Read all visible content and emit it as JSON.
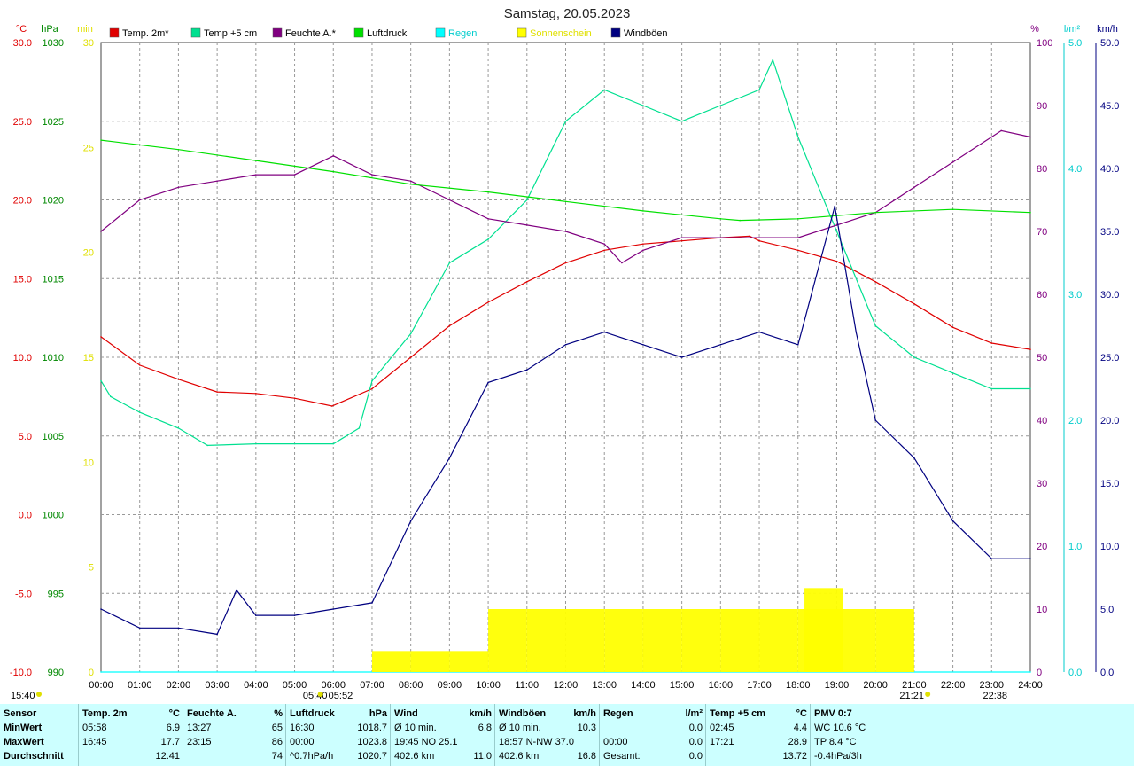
{
  "title": "Samstag, 20.05.2023",
  "axes": {
    "temp": {
      "unit": "°C",
      "ticks": [
        "30.0",
        "25.0",
        "20.0",
        "15.0",
        "10.0",
        "5.0",
        "0.0",
        "-5.0",
        "-10.0"
      ],
      "color": "#ff0000"
    },
    "pressure": {
      "unit": "hPa",
      "ticks": [
        "1030",
        "1025",
        "1020",
        "1015",
        "1010",
        "1005",
        "1000",
        "995",
        "990"
      ],
      "color": "#00aa00"
    },
    "sunshine": {
      "unit": "min",
      "ticks": [
        "30",
        "25",
        "20",
        "15",
        "10",
        "5",
        "0"
      ],
      "color": "#ffff00"
    },
    "humidity": {
      "unit": "%",
      "ticks": [
        "100",
        "90",
        "80",
        "70",
        "60",
        "50",
        "40",
        "30",
        "20",
        "10",
        "0"
      ],
      "color": "#800080"
    },
    "rain": {
      "unit": "l/m²",
      "ticks": [
        "5.0",
        "4.0",
        "3.0",
        "2.0",
        "1.0",
        "0.0"
      ],
      "color": "#00cccc"
    },
    "wind": {
      "unit": "km/h",
      "ticks": [
        "50.0",
        "45.0",
        "40.0",
        "35.0",
        "30.0",
        "25.0",
        "20.0",
        "15.0",
        "10.0",
        "5.0",
        "0.0"
      ],
      "color": "#000080"
    }
  },
  "x_ticks": [
    "00:00",
    "01:00",
    "02:00",
    "03:00",
    "04:00",
    "05:00",
    "06:00",
    "07:00",
    "08:00",
    "09:00",
    "10:00",
    "11:00",
    "12:00",
    "13:00",
    "14:00",
    "15:00",
    "16:00",
    "17:00",
    "18:00",
    "19:00",
    "20:00",
    "21:00",
    "22:00",
    "23:00",
    "24:00"
  ],
  "sun_markers": {
    "sunrise": "05:40",
    "sunset": "21:21",
    "moonrise": "05:52",
    "moonset": "22:38"
  },
  "corner_time": "15:40",
  "chart_data": {
    "type": "line",
    "x_range": [
      "00:00",
      "24:00"
    ],
    "series": [
      {
        "name": "Temp. 2m*",
        "color": "#e00000",
        "axis": "temp",
        "x": [
          "00:00",
          "01:00",
          "02:00",
          "03:00",
          "04:00",
          "05:00",
          "05:58",
          "07:00",
          "08:00",
          "09:00",
          "10:00",
          "11:00",
          "12:00",
          "13:00",
          "14:00",
          "15:00",
          "16:00",
          "16:45",
          "17:00",
          "18:00",
          "19:00",
          "20:00",
          "21:00",
          "22:00",
          "23:00",
          "24:00"
        ],
        "y": [
          11.3,
          9.5,
          8.6,
          7.8,
          7.7,
          7.4,
          6.9,
          8.0,
          10.0,
          12.0,
          13.5,
          14.8,
          16.0,
          16.8,
          17.2,
          17.4,
          17.6,
          17.7,
          17.4,
          16.8,
          16.1,
          14.8,
          13.4,
          11.9,
          10.9,
          10.5
        ]
      },
      {
        "name": "Temp +5 cm",
        "color": "#00e090",
        "axis": "temp",
        "x": [
          "00:00",
          "00:15",
          "01:00",
          "02:00",
          "02:45",
          "04:00",
          "05:00",
          "06:00",
          "06:40",
          "07:00",
          "08:00",
          "09:00",
          "10:00",
          "11:00",
          "12:00",
          "13:00",
          "14:00",
          "15:00",
          "16:00",
          "17:00",
          "17:21",
          "18:00",
          "18:30",
          "19:00",
          "20:00",
          "21:00",
          "22:00",
          "23:00",
          "24:00"
        ],
        "y": [
          8.5,
          7.5,
          6.5,
          5.5,
          4.4,
          4.5,
          4.5,
          4.5,
          5.5,
          8.5,
          11.5,
          16.0,
          17.5,
          20.0,
          25.0,
          27.0,
          26.0,
          25.0,
          26.0,
          27.0,
          28.9,
          24.0,
          21.0,
          18.0,
          12.0,
          10.0,
          9.0,
          8.0,
          8.0
        ]
      },
      {
        "name": "Feuchte A.*",
        "color": "#800080",
        "axis": "humidity",
        "x": [
          "00:00",
          "01:00",
          "02:00",
          "03:00",
          "04:00",
          "05:00",
          "06:00",
          "07:00",
          "08:00",
          "09:00",
          "10:00",
          "11:00",
          "12:00",
          "13:00",
          "13:27",
          "14:00",
          "15:00",
          "16:00",
          "17:00",
          "18:00",
          "19:00",
          "20:00",
          "21:00",
          "22:00",
          "23:00",
          "23:15",
          "24:00"
        ],
        "y": [
          70,
          75,
          77,
          78,
          79,
          79,
          82,
          79,
          78,
          75,
          72,
          71,
          70,
          68,
          65,
          67,
          69,
          69,
          69,
          69,
          71,
          73,
          77,
          81,
          85,
          86,
          85
        ]
      },
      {
        "name": "Luftdruck",
        "color": "#00e000",
        "axis": "pressure",
        "x": [
          "00:00",
          "02:00",
          "04:00",
          "06:00",
          "08:00",
          "10:00",
          "12:00",
          "14:00",
          "16:00",
          "16:30",
          "18:00",
          "20:00",
          "22:00",
          "24:00"
        ],
        "y": [
          1023.8,
          1023.2,
          1022.5,
          1021.8,
          1021.0,
          1020.5,
          1019.9,
          1019.3,
          1018.8,
          1018.7,
          1018.8,
          1019.2,
          1019.4,
          1019.2
        ]
      },
      {
        "name": "Regen",
        "color": "#00ffff",
        "axis": "rain",
        "x": [
          "00:00",
          "24:00"
        ],
        "y": [
          0.0,
          0.0
        ]
      },
      {
        "name": "Sonnenschein",
        "color": "#ffff00",
        "axis": "sunshine",
        "type": "bar",
        "x": [
          "07:00",
          "08:00",
          "09:00",
          "10:00",
          "11:00",
          "12:00",
          "13:00",
          "14:00",
          "15:00",
          "16:00",
          "17:00",
          "18:00",
          "18:10",
          "19:00",
          "20:00"
        ],
        "y": [
          1,
          1,
          1,
          3,
          3,
          3,
          3,
          3,
          3,
          3,
          3,
          3,
          4,
          3,
          3
        ]
      },
      {
        "name": "Windböen",
        "color": "#000080",
        "axis": "wind",
        "x": [
          "00:00",
          "01:00",
          "02:00",
          "03:00",
          "03:30",
          "04:00",
          "05:00",
          "06:00",
          "07:00",
          "08:00",
          "09:00",
          "10:00",
          "11:00",
          "12:00",
          "13:00",
          "14:00",
          "15:00",
          "16:00",
          "17:00",
          "18:00",
          "18:57",
          "19:30",
          "20:00",
          "21:00",
          "22:00",
          "23:00",
          "24:00"
        ],
        "y": [
          5.0,
          3.5,
          3.5,
          3.0,
          6.5,
          4.5,
          4.5,
          5.0,
          5.5,
          12.0,
          17.0,
          23.0,
          24.0,
          26.0,
          27.0,
          26.0,
          25.0,
          26.0,
          27.0,
          26.0,
          37.0,
          27.0,
          20.0,
          17.0,
          12.0,
          9.0,
          9.0
        ]
      }
    ]
  },
  "footer": {
    "columns": [
      {
        "header": [
          "Sensor",
          ""
        ],
        "rows": [
          [
            "MinWert",
            ""
          ],
          [
            "MaxWert",
            ""
          ],
          [
            "Durchschnitt",
            ""
          ]
        ]
      },
      {
        "header": [
          "Temp. 2m",
          "°C"
        ],
        "rows": [
          [
            "05:58",
            "6.9"
          ],
          [
            "16:45",
            "17.7"
          ],
          [
            "",
            "12.41"
          ]
        ]
      },
      {
        "header": [
          "Feuchte A.",
          "%"
        ],
        "rows": [
          [
            "13:27",
            "65"
          ],
          [
            "23:15",
            "86"
          ],
          [
            "",
            "74"
          ]
        ]
      },
      {
        "header": [
          "Luftdruck",
          "hPa"
        ],
        "rows": [
          [
            "16:30",
            "1018.7"
          ],
          [
            "00:00",
            "1023.8"
          ],
          [
            "^0.7hPa/h",
            "1020.7"
          ]
        ]
      },
      {
        "header": [
          "Wind",
          "km/h"
        ],
        "rows": [
          [
            "Ø 10 min.",
            "6.8"
          ],
          [
            "19:45     NO 25.1",
            ""
          ],
          [
            "402.6 km",
            "11.0"
          ]
        ]
      },
      {
        "header": [
          "Windböen",
          "km/h"
        ],
        "rows": [
          [
            "Ø 10 min.",
            "10.3"
          ],
          [
            "18:57     N-NW 37.0",
            ""
          ],
          [
            "402.6 km",
            "16.8"
          ]
        ]
      },
      {
        "header": [
          "Regen",
          "l/m²"
        ],
        "rows": [
          [
            "",
            "0.0"
          ],
          [
            "00:00",
            "0.0"
          ],
          [
            "Gesamt:",
            "0.0"
          ]
        ]
      },
      {
        "header": [
          "Temp +5 cm",
          "°C"
        ],
        "rows": [
          [
            "02:45",
            "4.4"
          ],
          [
            "17:21",
            "28.9"
          ],
          [
            "",
            "13.72"
          ]
        ]
      },
      {
        "header": [
          "PMV 0:7",
          ""
        ],
        "rows": [
          [
            "WC 10.6 °C",
            ""
          ],
          [
            "TP 8.4 °C",
            ""
          ],
          [
            "-0.4hPa/3h",
            ""
          ]
        ]
      }
    ]
  }
}
